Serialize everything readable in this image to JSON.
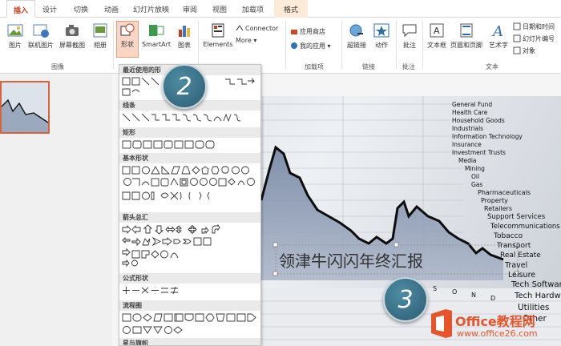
{
  "tabs": [
    "插入",
    "设计",
    "切换",
    "动画",
    "幻灯片放映",
    "审阅",
    "视图",
    "加载项",
    "格式"
  ],
  "ribbon": {
    "images": {
      "picture": "图片",
      "online_picture": "联机图片",
      "screenshot": "屏幕截图",
      "album": "相册",
      "group": "图像"
    },
    "illustrations": {
      "shapes": "形状",
      "smartart": "SmartArt",
      "chart": "图表"
    },
    "elements": {
      "label": "Elements",
      "connector": "Connector",
      "more": "More"
    },
    "addins": {
      "store": "应用商店",
      "my_apps": "我的应用",
      "group": "加载项"
    },
    "links": {
      "hyperlink": "超链接",
      "action": "动作",
      "group": "链接"
    },
    "comments": {
      "comment": "批注",
      "group": "批注"
    },
    "text": {
      "textbox": "文本框",
      "header_footer": "页眉和页脚",
      "wordart": "艺术字",
      "datetime": "日期和时间",
      "slide_number": "幻灯片编号",
      "object": "对象",
      "group": "文本"
    }
  },
  "dropdown": {
    "sections": [
      "最近使用的形",
      "线条",
      "矩形",
      "基本形状",
      "箭头总汇",
      "公式形状",
      "流程图",
      "星与旗帜"
    ]
  },
  "slide": {
    "title": "领津牛闪闪年终汇报",
    "stock_words": [
      "General Fund",
      "Health Care",
      "Household Goods",
      "Industrials",
      "Information Technology",
      "Insurance",
      "Investment Trusts",
      "Media",
      "Mining",
      "Oil",
      "Gas",
      "Pharmaceuticals",
      "Property",
      "Retailers",
      "Support Services",
      "Telecommunications",
      "Tobacco",
      "Transport",
      "Real Estate",
      "Travel",
      "Leisure",
      "Tech Software",
      "Tech Hardware",
      "Utilities",
      "Other"
    ],
    "months": [
      "A",
      "S",
      "O",
      "N",
      "D"
    ]
  },
  "callouts": {
    "c2": "2",
    "c3": "3"
  },
  "watermark": {
    "brand": "Office教程网",
    "url": "www.office26.com"
  },
  "colors": {
    "accent": "#c43e1c",
    "callout": "#2c5d73",
    "selection": "#d8623a"
  }
}
